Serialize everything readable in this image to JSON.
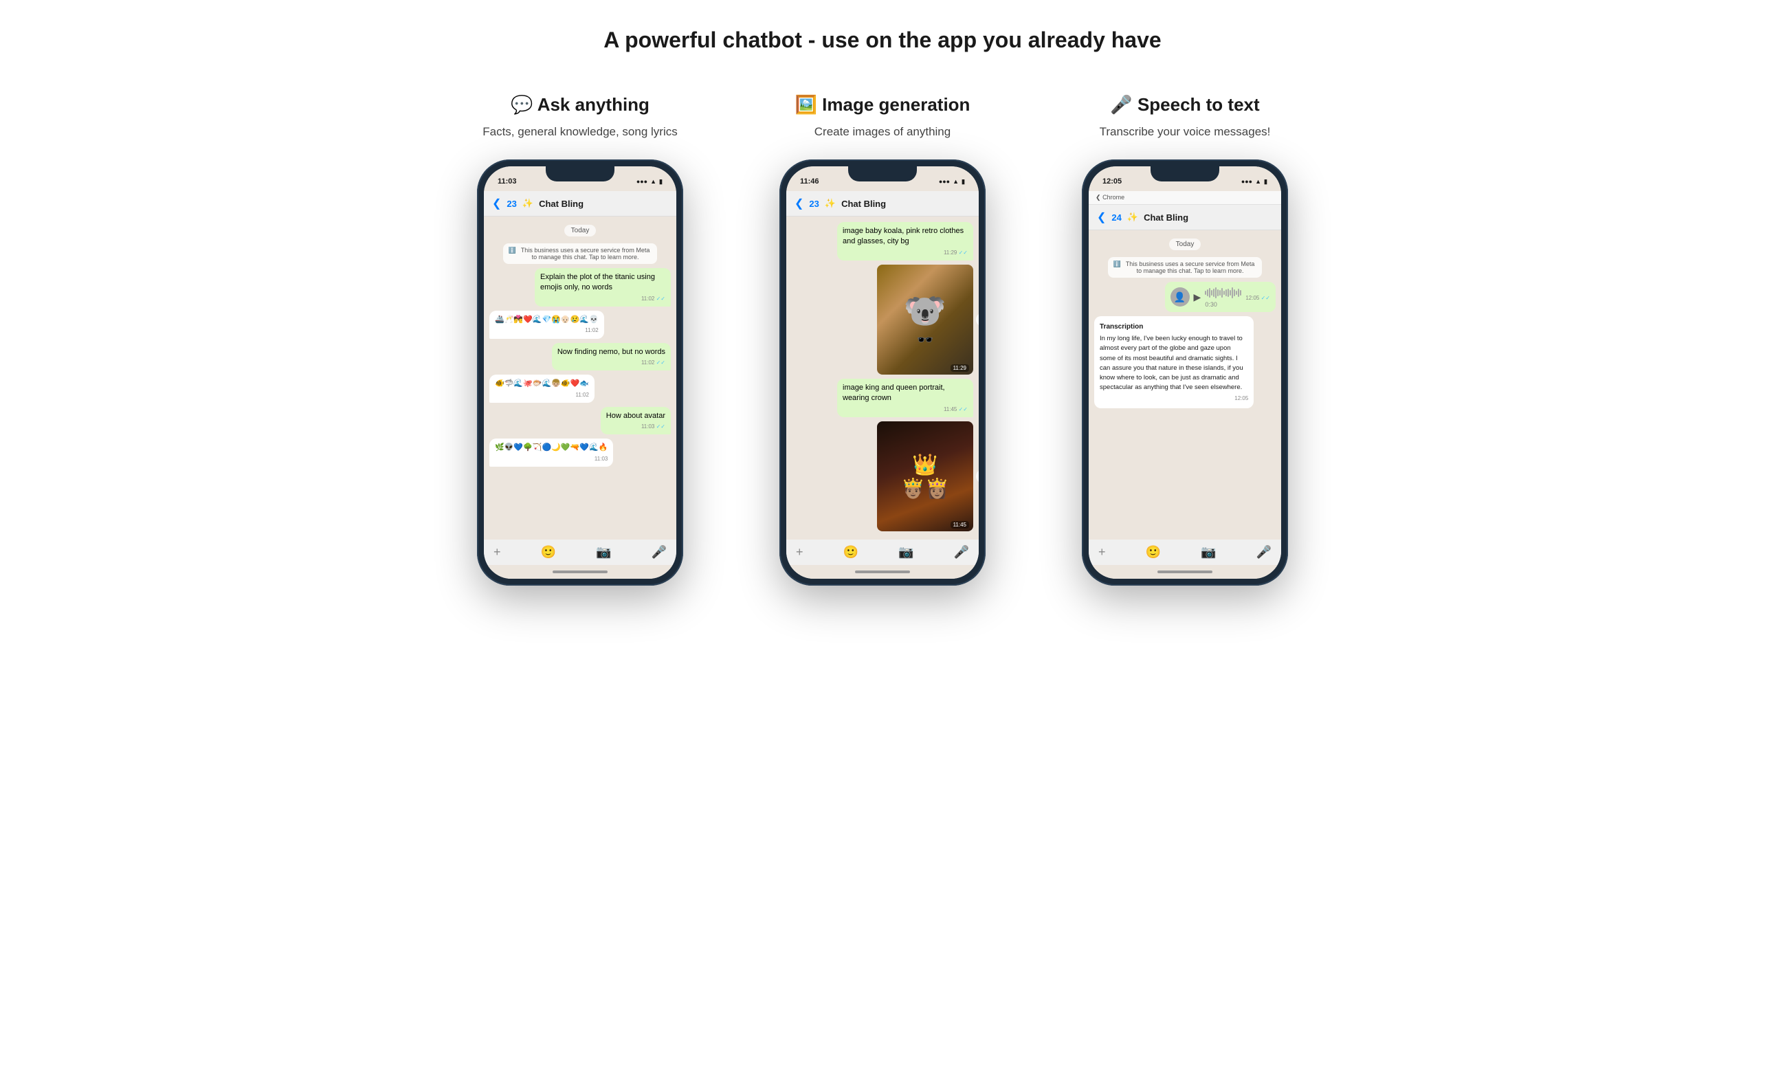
{
  "page": {
    "title": "A powerful chatbot - use on the app you already have"
  },
  "features": [
    {
      "id": "ask-anything",
      "icon": "💬",
      "title": "Ask anything",
      "subtitle": "Facts, general knowledge, song lyrics",
      "phone": {
        "time": "11:03",
        "nav_back": "❮",
        "chat_num": "23",
        "chat_name": "Chat Bling",
        "date_label": "Today",
        "system_msg": "This business uses a secure service from Meta to manage this chat. Tap to learn more.",
        "messages": [
          {
            "type": "sent",
            "text": "Explain the plot of the titanic using emojis only, no words",
            "time": "11:02",
            "check": true
          },
          {
            "type": "received",
            "text": "🚢🥂💏❤️🌊💎😭👴🏻😢🌊💀",
            "time": "11:02"
          },
          {
            "type": "sent",
            "text": "Now finding nemo, but no words",
            "time": "11:02",
            "check": true
          },
          {
            "type": "received",
            "text": "🐠🐟🦈🌊🐙🐡💧🐟👦🏼🐠❤️",
            "time": "11:02"
          },
          {
            "type": "sent",
            "text": "How about avatar",
            "time": "11:03",
            "check": true
          },
          {
            "type": "received",
            "text": "🌿👽💙🌳🏹🔵🌙👤💚🔫💙🌊🔥",
            "time": "11:03"
          }
        ]
      }
    },
    {
      "id": "image-generation",
      "icon": "🖼️",
      "title": "Image generation",
      "subtitle": "Create images of anything",
      "phone": {
        "time": "11:46",
        "nav_back": "❮",
        "chat_num": "23",
        "chat_name": "Chat Bling",
        "messages": [
          {
            "type": "sent",
            "text": "image baby koala, pink retro clothes and glasses, city bg",
            "time": "11:29",
            "check": true
          },
          {
            "type": "img",
            "img_type": "koala",
            "time": "11:29",
            "emoji": "🐨"
          },
          {
            "type": "sent",
            "text": "image king and queen portrait, wearing crown",
            "time": "11:45",
            "check": true
          },
          {
            "type": "img",
            "img_type": "king",
            "time": "11:45",
            "emoji": "👑"
          }
        ]
      }
    },
    {
      "id": "speech-to-text",
      "icon": "🎤",
      "title": "Speech to text",
      "subtitle": "Transcribe your voice messages!",
      "phone": {
        "time": "12:05",
        "nav_back": "❮",
        "chat_num": "24",
        "chat_name": "Chat Bling",
        "chrome_label": "Chrome",
        "date_label": "Today",
        "system_msg": "This business uses a secure service from Meta to manage this chat. Tap to learn more.",
        "voice": {
          "duration": "0:30",
          "time": "12:05"
        },
        "transcription": {
          "title": "Transcription",
          "text": "In my long life, I've been lucky enough to travel to almost every part of the globe and gaze upon some of its most beautiful and dramatic sights. I can assure you that nature in these islands, if you know where to look, can be just as dramatic and spectacular as anything that I've seen elsewhere.",
          "time": "12:05"
        }
      }
    }
  ],
  "bottom_bar": {
    "plus": "+",
    "emoji_icon": "🙂",
    "camera_icon": "📷",
    "mic_icon": "🎤"
  }
}
